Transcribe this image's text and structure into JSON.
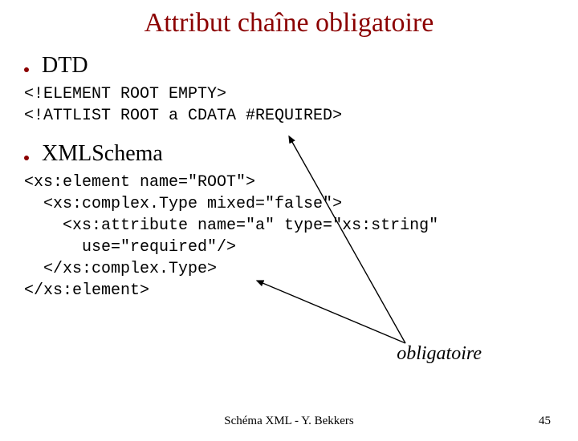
{
  "title": "Attribut chaîne obligatoire",
  "bullets": {
    "dtd": "DTD",
    "xmlschema": "XMLSchema"
  },
  "code": {
    "dtd": "<!ELEMENT ROOT EMPTY>\n<!ATTLIST ROOT a CDATA #REQUIRED>",
    "xmlschema": "<xs:element name=\"ROOT\">\n  <xs:complex.Type mixed=\"false\">\n    <xs:attribute name=\"a\" type=\"xs:string\"\n      use=\"required\"/>\n  </xs:complex.Type>\n</xs:element>"
  },
  "annotation": "obligatoire",
  "footer": "Schéma XML - Y. Bekkers",
  "page": "45"
}
